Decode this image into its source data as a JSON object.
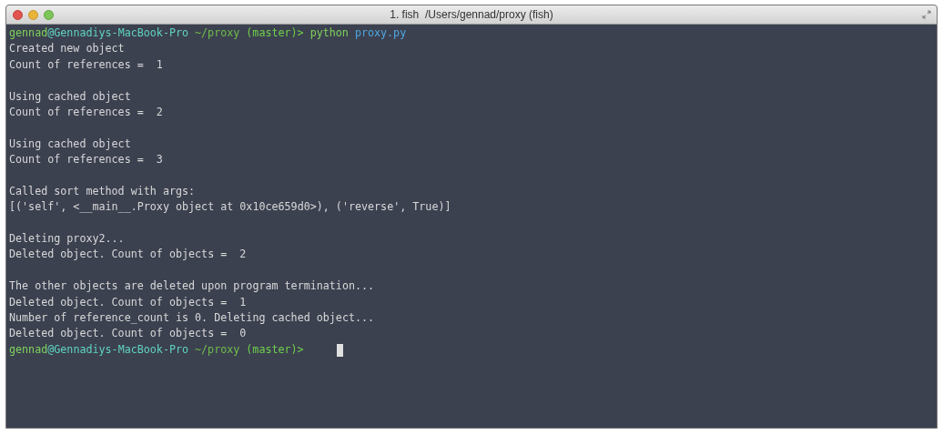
{
  "window": {
    "title": "1. fish  /Users/gennad/proxy (fish)"
  },
  "terminal": {
    "lines": [
      {
        "kind": "prompt",
        "segments": [
          {
            "kind": "user",
            "text": "gennad"
          },
          {
            "kind": "host",
            "text": "@Gennadiys-MacBook-Pro"
          },
          {
            "kind": "cwd",
            "text": "~/proxy"
          },
          {
            "kind": "branch",
            "text": "(master)>"
          },
          {
            "kind": "command",
            "text": "python"
          },
          {
            "kind": "argument",
            "text": "proxy.py"
          }
        ]
      },
      {
        "kind": "output",
        "text": "Created new object"
      },
      {
        "kind": "output",
        "text": "Count of references =  1"
      },
      {
        "kind": "blank"
      },
      {
        "kind": "output",
        "text": "Using cached object"
      },
      {
        "kind": "output",
        "text": "Count of references =  2"
      },
      {
        "kind": "blank"
      },
      {
        "kind": "output",
        "text": "Using cached object"
      },
      {
        "kind": "output",
        "text": "Count of references =  3"
      },
      {
        "kind": "blank"
      },
      {
        "kind": "output",
        "text": "Called sort method with args:"
      },
      {
        "kind": "output",
        "text": "[('self', <__main__.Proxy object at 0x10ce659d0>), ('reverse', True)]"
      },
      {
        "kind": "blank"
      },
      {
        "kind": "output",
        "text": "Deleting proxy2..."
      },
      {
        "kind": "output",
        "text": "Deleted object. Count of objects =  2"
      },
      {
        "kind": "blank"
      },
      {
        "kind": "output",
        "text": "The other objects are deleted upon program termination..."
      },
      {
        "kind": "output",
        "text": "Deleted object. Count of objects =  1"
      },
      {
        "kind": "output",
        "text": "Number of reference_count is 0. Deleting cached object..."
      },
      {
        "kind": "output",
        "text": "Deleted object. Count of objects =  0"
      },
      {
        "kind": "prompt",
        "cursor": true,
        "segments": [
          {
            "kind": "user",
            "text": "gennad"
          },
          {
            "kind": "host",
            "text": "@Gennadiys-MacBook-Pro"
          },
          {
            "kind": "cwd",
            "text": "~/proxy"
          },
          {
            "kind": "branch",
            "text": "(master)>"
          }
        ]
      }
    ]
  }
}
